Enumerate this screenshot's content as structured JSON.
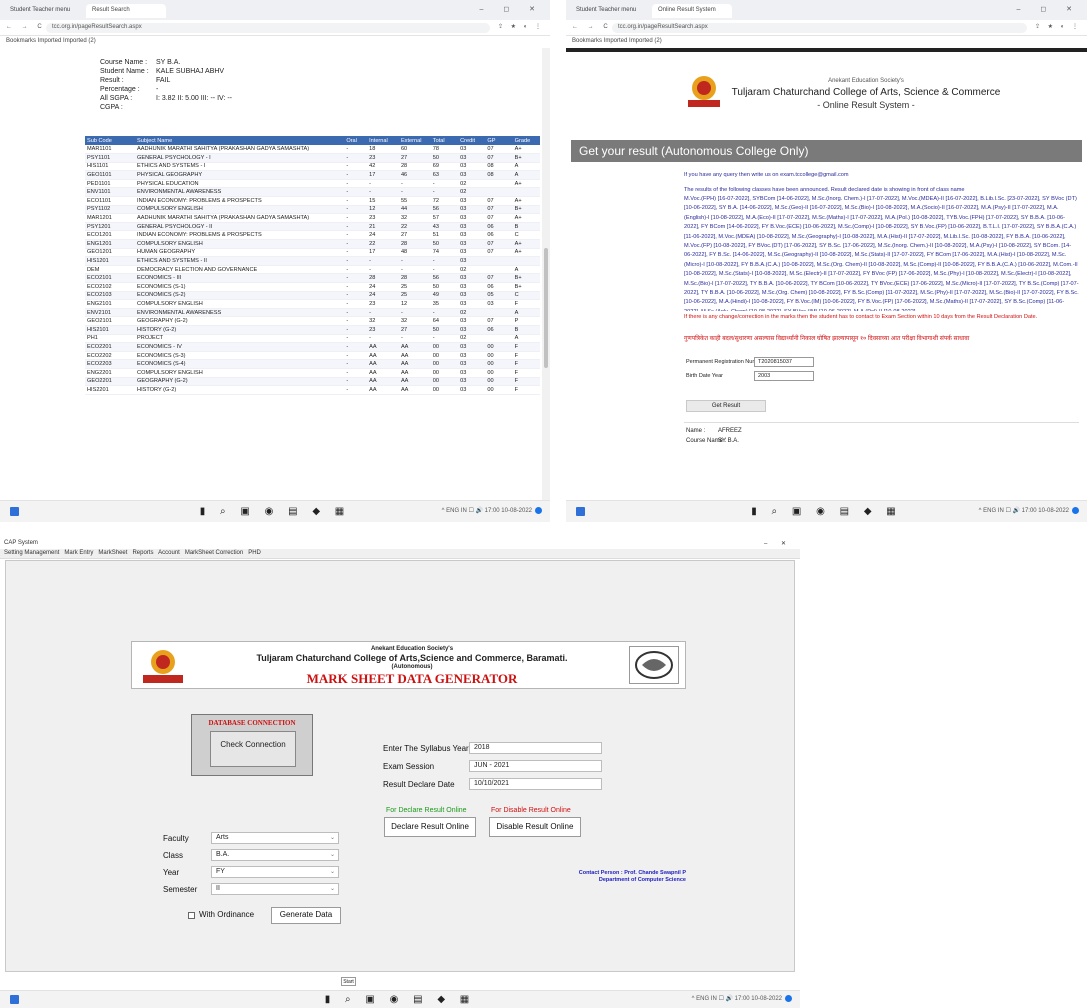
{
  "panel1": {
    "tabs": [
      "Student Teacher menu",
      "Result Search"
    ],
    "win_controls": "–  ◻  ✕",
    "url": "tcc.org.in/pageResultSearch.aspx",
    "bookmarks": "Bookmarks   Imported   Imported (2)",
    "student": [
      {
        "k": "Course Name :",
        "v": "SY B.A."
      },
      {
        "k": "Student Name :",
        "v": "KALE SUBHAJ ABHV"
      },
      {
        "k": "Result :",
        "v": "FAIL"
      },
      {
        "k": "Percentage :",
        "v": "-"
      },
      {
        "k": "All SGPA :",
        "v": "I: 3.82 II: 5.00 III: -- IV: --"
      },
      {
        "k": "CGPA :",
        "v": ""
      }
    ],
    "headers": [
      "Sub Code",
      "Subject Name",
      "Oral",
      "Internal",
      "External",
      "Total",
      "Credit",
      "GP",
      "Grade"
    ],
    "rows": [
      [
        "MAR1101",
        "AADHUNIK MARATHI SAHITYA (PRAKASHAN GADYA SAMASHTA)",
        "-",
        "18",
        "60",
        "78",
        "03",
        "07",
        "A+"
      ],
      [
        "PSY1101",
        "GENERAL PSYCHOLOGY - I",
        "-",
        "23",
        "27",
        "50",
        "03",
        "07",
        "B+"
      ],
      [
        "HIS1101",
        "ETHICS AND SYSTEMS - I",
        "-",
        "42",
        "28",
        "69",
        "03",
        "08",
        "A"
      ],
      [
        "GEO1101",
        "PHYSICAL GEOGRAPHY",
        "-",
        "17",
        "46",
        "63",
        "03",
        "08",
        "A"
      ],
      [
        "PED1101",
        "PHYSICAL EDUCATION",
        "-",
        "-",
        "-",
        "-",
        "02",
        "",
        "A+"
      ],
      [
        "ENV1101",
        "ENVIRONMENTAL AWARENESS",
        "-",
        "-",
        "-",
        "-",
        "02",
        "",
        ""
      ],
      [
        "ECO1101",
        "INDIAN ECONOMY: PROBLEMS & PROSPECTS",
        "-",
        "15",
        "55",
        "72",
        "03",
        "07",
        "A+"
      ],
      [
        "PSY1102",
        "COMPULSORY ENGLISH",
        "-",
        "12",
        "44",
        "56",
        "03",
        "07",
        "B+"
      ],
      [
        "MAR1201",
        "AADHUNIK MARATHI SAHITYA (PRAKASHAN GADYA SAMASHTA)",
        "-",
        "23",
        "32",
        "57",
        "03",
        "07",
        "A+"
      ],
      [
        "PSY1201",
        "GENERAL PSYCHOLOGY - II",
        "-",
        "21",
        "22",
        "43",
        "03",
        "06",
        "B"
      ],
      [
        "ECO1201",
        "INDIAN ECONOMY: PROBLEMS & PROSPECTS",
        "-",
        "24",
        "27",
        "51",
        "03",
        "06",
        "C"
      ],
      [
        "ENG1201",
        "COMPULSORY ENGLISH",
        "-",
        "22",
        "28",
        "50",
        "03",
        "07",
        "A+"
      ],
      [
        "GEO1201",
        "HUMAN GEOGRAPHY",
        "-",
        "17",
        "48",
        "74",
        "03",
        "07",
        "A+"
      ],
      [
        "HIS1201",
        "ETHICS AND SYSTEMS - II",
        "-",
        "-",
        "-",
        "-",
        "03",
        "",
        ""
      ],
      [
        "DEM",
        "DEMOCRACY ELECTION AND GOVERNANCE",
        "-",
        "-",
        "-",
        "-",
        "02",
        "",
        "A"
      ],
      [
        "ECO2101",
        "ECONOMICS - III",
        "-",
        "28",
        "28",
        "56",
        "03",
        "07",
        "B+"
      ],
      [
        "ECO2102",
        "ECONOMICS (S-1)",
        "-",
        "24",
        "25",
        "50",
        "03",
        "06",
        "B+"
      ],
      [
        "ECO2103",
        "ECONOMICS (S-2)",
        "-",
        "24",
        "25",
        "49",
        "03",
        "05",
        "C"
      ],
      [
        "ENG2101",
        "COMPULSORY ENGLISH",
        "-",
        "23",
        "12",
        "35",
        "03",
        "03",
        "F"
      ],
      [
        "ENV2101",
        "ENVIRONMENTAL AWARENESS",
        "-",
        "-",
        "-",
        "-",
        "02",
        "",
        "A"
      ],
      [
        "GEO2101",
        "GEOGRAPHY (G-2)",
        "-",
        "32",
        "32",
        "64",
        "03",
        "07",
        "P"
      ],
      [
        "HIS2101",
        "HISTORY (G-2)",
        "-",
        "23",
        "27",
        "50",
        "03",
        "06",
        "B"
      ],
      [
        "PH1",
        "PROJECT",
        "-",
        "-",
        "-",
        "-",
        "02",
        "",
        "A"
      ],
      [
        "ECO2201",
        "ECONOMICS - IV",
        "-",
        "AA",
        "AA",
        "00",
        "03",
        "00",
        "F"
      ],
      [
        "ECO2202",
        "ECONOMICS (S-3)",
        "-",
        "AA",
        "AA",
        "00",
        "03",
        "00",
        "F"
      ],
      [
        "ECO2203",
        "ECONOMICS (S-4)",
        "-",
        "AA",
        "AA",
        "00",
        "03",
        "00",
        "F"
      ],
      [
        "ENG2201",
        "COMPULSORY ENGLISH",
        "-",
        "AA",
        "AA",
        "00",
        "03",
        "00",
        "F"
      ],
      [
        "GEO2201",
        "GEOGRAPHY (G-2)",
        "-",
        "AA",
        "AA",
        "00",
        "03",
        "00",
        "F"
      ],
      [
        "HIS2201",
        "HISTORY (G-2)",
        "-",
        "AA",
        "AA",
        "00",
        "03",
        "00",
        "F"
      ]
    ]
  },
  "panel2": {
    "tabs": [
      "Student Teacher menu",
      "Online Result System"
    ],
    "win_controls": "–  ◻  ✕",
    "url": "tcc.org.in/pageResultSearch.aspx",
    "bookmarks": "Bookmarks   Imported   Imported (2)",
    "society": "Anekant Education Society's",
    "college": "Tuljaram Chaturchand College of Arts, Science & Commerce",
    "system": "- Online Result System -",
    "banner": "Get your result (Autonomous College Only)",
    "query": "If you have any query then write us on exam.tccollege@gmail.com",
    "intro": "The results of the following classes have been announced. Result declared date is showing in front of class name",
    "classes": "M.Voc.(FPH) [16-07-2022], SYBCom [14-06-2022], M.Sc.(Inorg. Chem.)-I [17-07-2022], M.Voc.(MDEA)-II [16-07-2022], B.Lib.I.Sc. [23-07-2022], SY BVoc (DT) [10-06-2022], SY B.A. [14-06-2022], M.Sc.(Geo)-II [16-07-2022], M.Sc.(Bio)-I [10-08-2022], M.A.(Socio)-II [16-07-2022], M.A.(Psy)-II [17-07-2022], M.A.(English)-I [10-08-2022], M.A.(Eco)-II [17-07-2022], M.Sc.(Maths)-I [17-07-2022], M.A.(Pol.) [10-08-2022], TYB.Voc.(FPH) [17-07-2022], SY B.B.A. [10-06-2022], FY BCom [14-06-2022], FY B.Voc.(ECE) [10-06-2022], M.Sc.(Comp)-I [10-08-2022], SY B.Voc.(FP) [10-06-2022], B.T.L.I. [17-07-2022], SY B.B.A.(C.A.) [11-06-2022], M.Voc.(MDEA) [10-08-2022], M.Sc.(Geography)-I [10-08-2022], M.A.(Hist)-II [17-07-2022], M.Lib.I.Sc. [10-08-2022], FY B.B.A. [10-06-2022], M.Voc.(FP) [10-08-2022], FY BVoc.(DT) [17-06-2022], SY B.Sc. [17-06-2022], M.Sc.(Inorg. Chem.)-II [10-08-2022], M.A.(Psy)-I [10-08-2022], SY BCom. [14-06-2022], FY B.Sc. [14-06-2022], M.Sc.(Geography)-II [10-08-2022], M.Sc.(Stats)-II [17-07-2022], FY BCom [17-06-2022], M.A.(Hist)-I [10-08-2022], M.Sc.(Micro)-I [10-08-2022], FY B.B.A.(C.A.) [10-08-2022], M.Sc.(Org. Chem)-II [10-08-2022], M.Sc.(Comp)-II [10-08-2022], FY B.B.A.(C.A.) [10-06-2022], M.Com.-II [10-08-2022], M.Sc.(Stats)-I [10-08-2022], M.Sc.(Electr)-II [17-07-2022], FY BVoc (FP) [17-06-2022], M.Sc.(Phy)-I [10-08-2022], M.Sc.(Electr)-I [10-08-2022], M.Sc.(Bio)-I [17-07-2022], TY B.B.A. [10-06-2022], TY BCom [10-06-2022], TY BVoc.(ECE) [17-06-2022], M.Sc.(Micro)-II [17-07-2022], TY B.Sc.(Comp) [17-07-2022], TY B.B.A. [10-06-2022], M.Sc.(Org. Chem) [10-08-2022], FY B.Sc.(Comp) [11-07-2022], M.Sc.(Phy)-II [17-07-2022], M.Sc.(Bio)-II [17-07-2022], FY B.Sc. [10-06-2022], M.A.(Hindi)-I [10-08-2022], FY B.Voc.(IM) [10-06-2022], FY B.Voc.(FP) [17-06-2022], M.Sc.(Maths)-II [17-07-2022], SY B.Sc.(Comp) [11-06-2022], M.Sc.(Anly. Chem) [10-08-2022], SY BVoc.(IM) [10-06-2022], M.A.(Pol)-II [10-08-2022]",
    "warning_en": "If there is any change/correction in the marks then the student has to contact to Exam Section within 10 days from the Result Declaration Date.",
    "warning_mr": "गुणपत्रिकेत काही बदल/सुधारणा असल्यास विद्यार्थ्यांनी निकाल घोषित झाल्यापासून १० दिवसाच्या आत परीक्षा विभागाशी संपर्क साधावा",
    "perm_label": "Permanent Registration Number (PRN)",
    "perm_value": "T2020815037",
    "dob_label": "Birth Date Year",
    "dob_value": "2003",
    "submit": "Get Result",
    "name_label": "Name :",
    "name_value": "AFREEZ",
    "course_label": "Course Name :",
    "course_value": "SY B.A."
  },
  "panel3": {
    "app_title": "CAP System",
    "menu": [
      "Setting Management",
      "Mark Entry",
      "MarkSheet",
      "Reports",
      "Account",
      "MarkSheet Correction",
      "PHD"
    ],
    "society": "Anekant Education Society's",
    "college": "Tuljaram Chaturchand College of Arts,Science and Commerce, Baramati.",
    "autonomous": "(Autonomous)",
    "title": "MARK SHEET DATA GENERATOR",
    "db_title": "DATABASE CONNECTION",
    "check_conn": "Check Connection",
    "faculty_label": "Faculty",
    "faculty": "Arts",
    "class_label": "Class",
    "class": "B.A.",
    "year_label": "Year",
    "year": "FY",
    "semester_label": "Semester",
    "semester": "II",
    "ordinance_label": "With Ordinance",
    "generate": "Generate Data",
    "syllabus_label": "Enter The Syllabus Year",
    "syllabus": "2018",
    "session_label": "Exam Session",
    "session": "JUN - 2021",
    "declare_date_label": "Result Declare Date",
    "declare_date": "10/10/2021",
    "declare_online_label": "For Declare Result Online",
    "disable_online_label": "For Disable Result Online",
    "declare_btn": "Declare Result Online",
    "disable_btn": "Disable Result Online",
    "contact1": "Contact Person : Prof. Chande Swapnil P",
    "contact2": "Department of Computer Science",
    "start": "Start",
    "win_controls": "–  ✕"
  },
  "taskbar": {
    "tray": "^  ENG IN  ☐  🔊  17:00 10-08-2022"
  },
  "colors": {
    "table_header": "#3b6ab1",
    "link_blue": "#2a2a9c",
    "alert_red": "#d01010",
    "title_red": "#cc1111"
  }
}
